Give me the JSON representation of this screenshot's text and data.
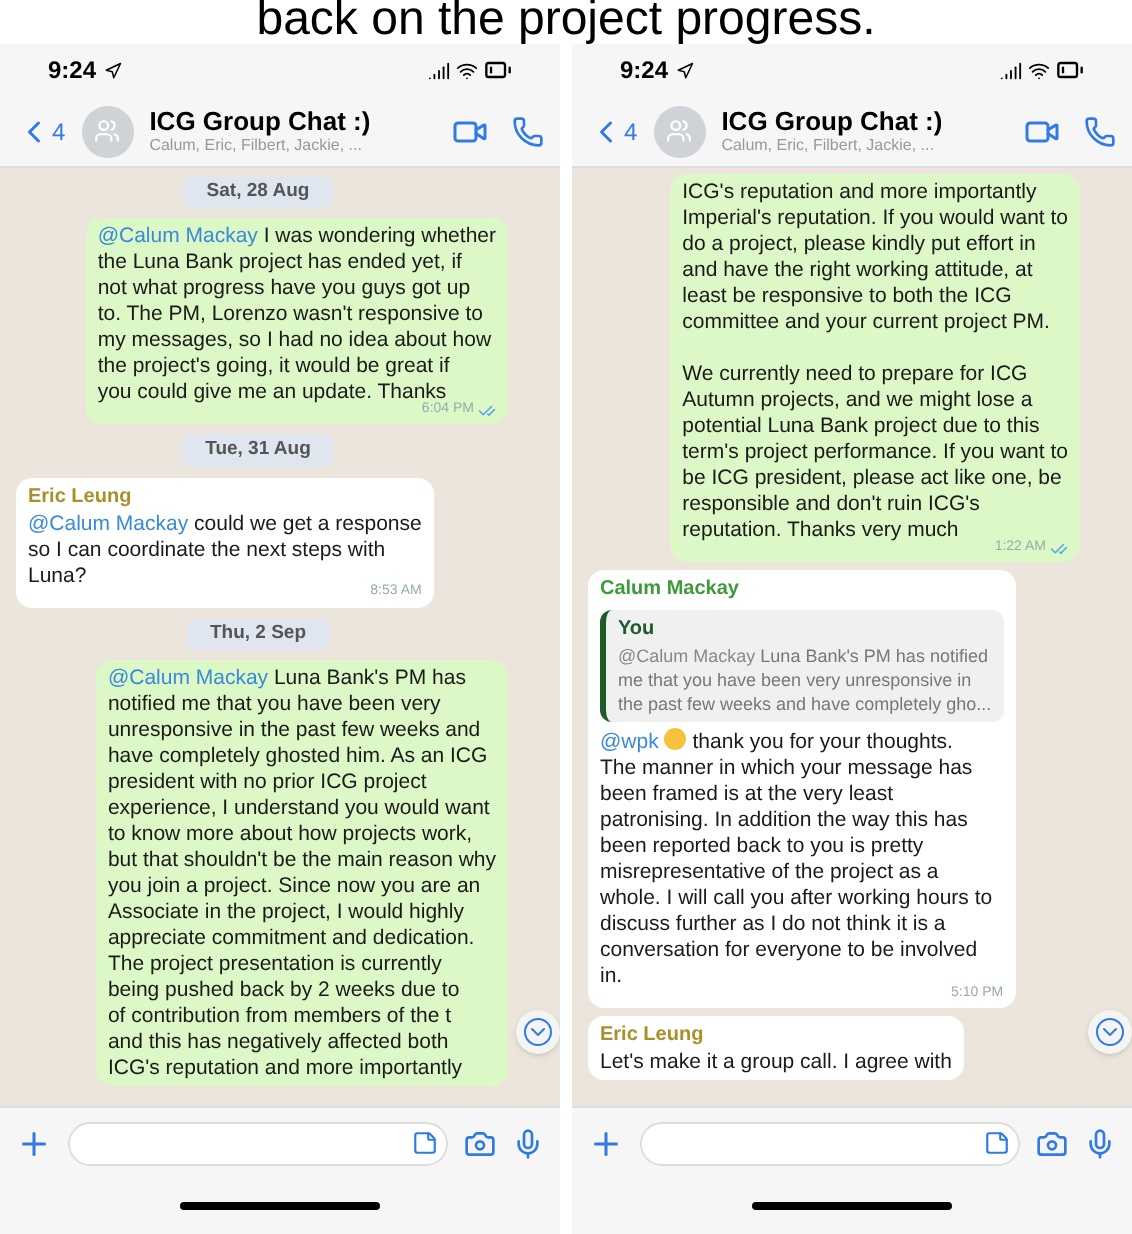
{
  "caption": "back on the project progress.",
  "phones": [
    {
      "status": {
        "time": "9:24"
      },
      "header": {
        "back_count": "4",
        "title": "ICG Group Chat :)",
        "subtitle": "Calum, Eric, Filbert, Jackie, ..."
      },
      "messages": [
        {
          "kind": "date",
          "text": "Sat, 28 Aug"
        },
        {
          "kind": "outgoing",
          "mention": "@Calum Mackay",
          "paragraphs": [
            [
              "I was wondering whether",
              "the Luna Bank project has ended yet, if",
              "not what progress have you guys got up",
              "to. The PM, Lorenzo wasn't responsive to",
              "my messages, so I had no idea about how",
              "the project's going, it would be great if",
              "you could give me an update. Thanks"
            ]
          ],
          "time": "6:04 PM",
          "read": true
        },
        {
          "kind": "date",
          "text": "Tue, 31 Aug"
        },
        {
          "kind": "incoming",
          "sender": {
            "name": "Eric Leung",
            "color": "#a8902a"
          },
          "mention": "@Calum Mackay",
          "paragraphs": [
            [
              "could we get a response",
              "so I can coordinate the next steps with",
              "Luna?"
            ]
          ],
          "time": "8:53 AM"
        },
        {
          "kind": "date",
          "text": "Thu, 2 Sep"
        },
        {
          "kind": "outgoing",
          "mention": "@Calum Mackay",
          "paragraphs": [
            [
              "Luna Bank's PM has",
              "notified me that you have been very",
              "unresponsive in the past few weeks and",
              "have completely ghosted him. As an ICG",
              "president with no prior ICG project",
              "experience, I understand you would want",
              "to know more about how projects work,",
              "but that shouldn't be the main reason why",
              "you join a project. Since now you are an",
              "Associate in the project, I would highly",
              "appreciate commitment and dedication.",
              "The project presentation is currently",
              "being pushed back by 2 weeks due to",
              "of contribution from members of the t",
              "and this has negatively affected both",
              "ICG's reputation and more importantly"
            ]
          ]
        }
      ]
    },
    {
      "status": {
        "time": "9:24"
      },
      "header": {
        "back_count": "4",
        "title": "ICG Group Chat :)",
        "subtitle": "Calum, Eric, Filbert, Jackie, ..."
      },
      "messages": [
        {
          "kind": "outgoing",
          "paragraphs": [
            [
              "ICG's reputation and more importantly",
              "Imperial's reputation. If you would want to",
              "do a project, please kindly put effort in",
              "and have the right working attitude, at",
              "least be responsive to both the ICG",
              "committee and your current project PM."
            ],
            [
              "We currently need to prepare for ICG",
              "Autumn projects, and we might lose a",
              "potential Luna Bank project due to this",
              "term's project performance. If you want to",
              "be ICG president, please act like one, be",
              "responsible and don't ruin ICG's",
              "reputation. Thanks very much"
            ]
          ],
          "time": "1:22 AM",
          "read": true
        },
        {
          "kind": "incoming",
          "sender": {
            "name": "Calum Mackay",
            "color": "#3e9a3a"
          },
          "quote": {
            "author": "You",
            "mention": "@Calum Mackay",
            "lines": [
              "Luna Bank's PM has notified",
              "me that you have been very unresponsive in",
              "the past few weeks and have completely gho..."
            ]
          },
          "mention": "@wpk",
          "emoji": true,
          "paragraphs": [
            [
              "thank you for your thoughts.",
              "The manner in which your message has",
              "been framed is at the very least",
              "patronising. In addition the way this has",
              "been reported back to you is pretty",
              "misrepresentative of the project as a",
              "whole. I will call you after working hours to",
              "discuss further as I do not think it is a",
              "conversation for everyone to be involved",
              "in."
            ]
          ],
          "time": "5:10 PM"
        },
        {
          "kind": "incoming",
          "sender": {
            "name": "Eric Leung",
            "color": "#a8902a"
          },
          "paragraphs": [
            [
              "Let's make it a group call. I agree with"
            ]
          ]
        }
      ]
    }
  ]
}
